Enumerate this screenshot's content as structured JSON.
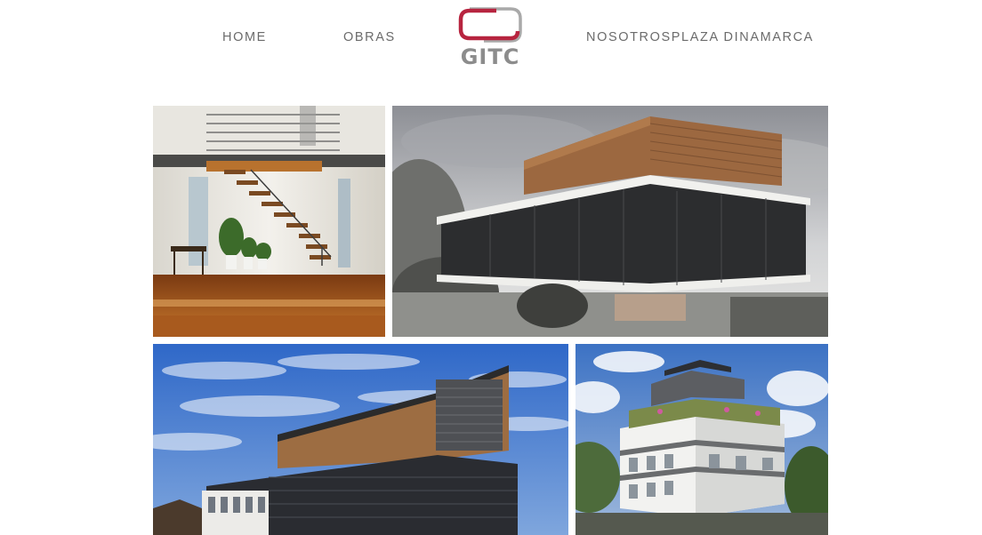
{
  "nav": {
    "items": [
      {
        "label": "HOME"
      },
      {
        "label": "OBRAS"
      },
      {
        "label": "NOSOTROSPLAZA DINAMARCA"
      }
    ],
    "logo_text": "GITC"
  },
  "colors": {
    "logo_red": "#b7243f",
    "logo_gray": "#8c8c8c",
    "nav_text": "#6b6b6b"
  },
  "gallery": {
    "tiles": [
      {
        "subject": "interior-staircase"
      },
      {
        "subject": "building-render-wood-facade"
      },
      {
        "subject": "building-render-blue-sky"
      },
      {
        "subject": "residential-building-green-roof"
      }
    ]
  }
}
